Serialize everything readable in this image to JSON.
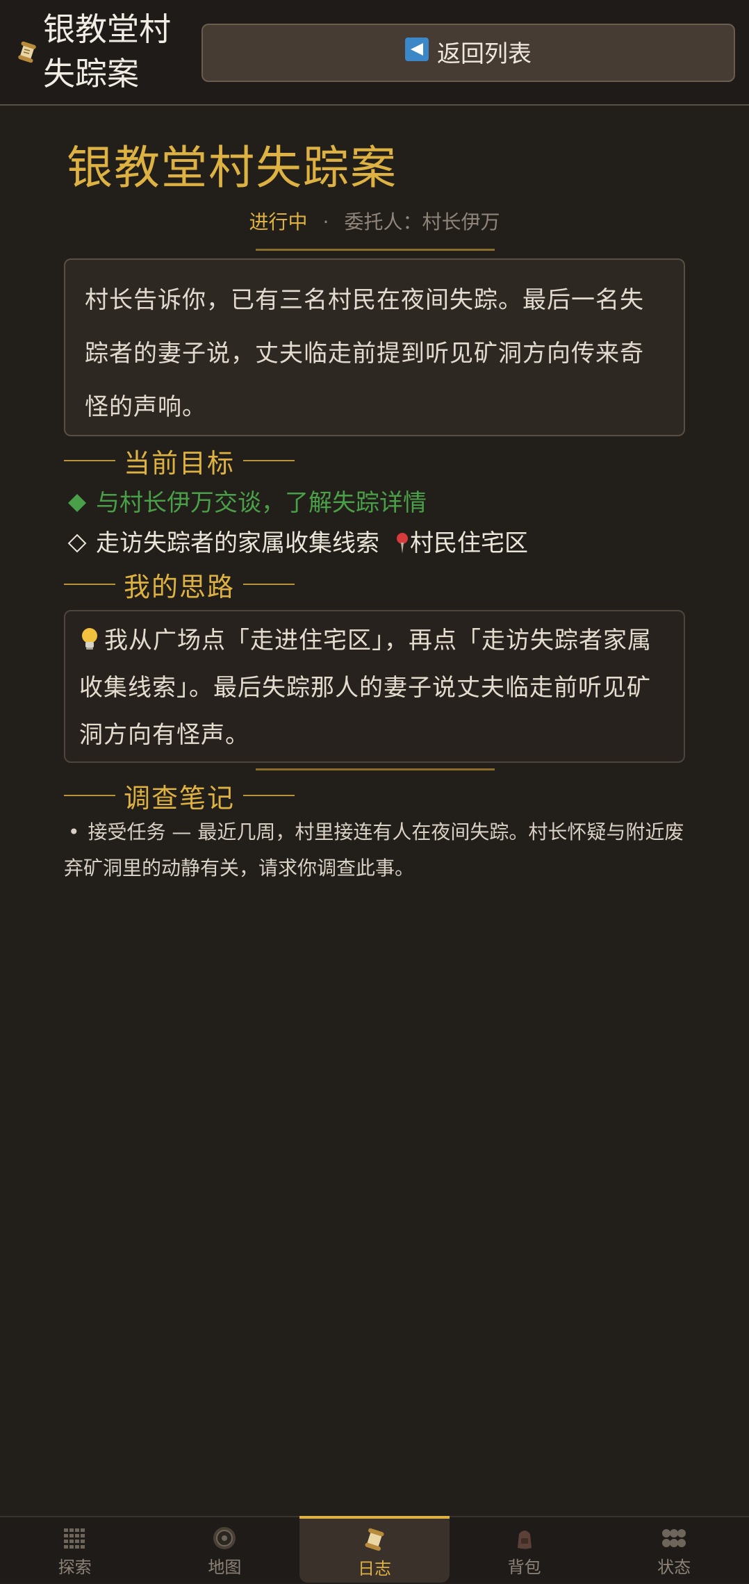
{
  "header": {
    "title": "银教堂村失踪案",
    "back_label": "返回列表"
  },
  "quest": {
    "title": "银教堂村失踪案",
    "status": "进行中",
    "separator": "·",
    "client": "委托人：村长伊万",
    "description": "村长告诉你，已有三名村民在夜间失踪。最后一名失踪者的妻子说，丈夫临走前提到听见矿洞方向传来奇怪的声响。"
  },
  "objectives": {
    "heading": "当前目标",
    "items": [
      {
        "text": "与村长伊万交谈，了解失踪详情",
        "completed": true
      },
      {
        "text": "走访失踪者的家属收集线索",
        "completed": false,
        "location": "村民住宅区"
      }
    ]
  },
  "thoughts": {
    "heading": "我的思路",
    "text": "我从广场点「走进住宅区」，再点「走访失踪者家属收集线索」。最后失踪那人的妻子说丈夫临走前听见矿洞方向有怪声。"
  },
  "notes": {
    "heading": "调查笔记",
    "bullet": "•",
    "items": [
      "接受任务 — 最近几周，村里接连有人在夜间失踪。村长怀疑与附近废弃矿洞里的动静有关，请求你调查此事。"
    ]
  },
  "nav": {
    "items": [
      {
        "label": "探索",
        "icon": "grid-icon"
      },
      {
        "label": "地图",
        "icon": "compass-icon"
      },
      {
        "label": "日志",
        "icon": "scroll-icon",
        "active": true
      },
      {
        "label": "背包",
        "icon": "backpack-icon"
      },
      {
        "label": "状态",
        "icon": "stats-icon"
      }
    ]
  },
  "colors": {
    "gold": "#ddb242",
    "completed": "#4aa048",
    "background": "#221e1a"
  }
}
